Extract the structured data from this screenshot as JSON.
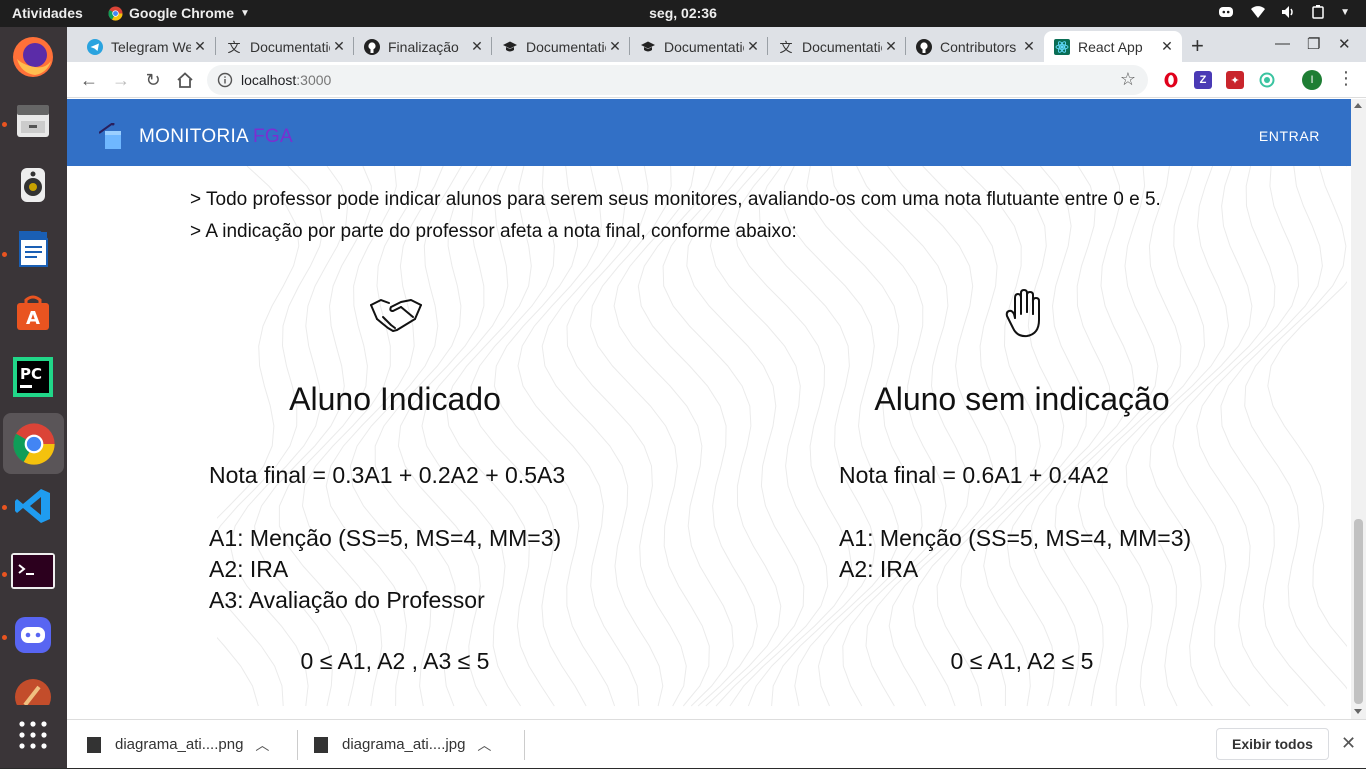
{
  "topbar": {
    "activities": "Atividades",
    "app_name": "Google Chrome",
    "clock": "seg, 02:36"
  },
  "tabs": [
    {
      "title": "Telegram Web",
      "icon": "telegram-icon"
    },
    {
      "title": "Documentation",
      "icon": "translate-icon"
    },
    {
      "title": "Finalização",
      "icon": "github-icon"
    },
    {
      "title": "Documentation",
      "icon": "graduation-cap-icon"
    },
    {
      "title": "Documentation",
      "icon": "graduation-cap-icon"
    },
    {
      "title": "Documentation",
      "icon": "translate-icon"
    },
    {
      "title": "Contributors",
      "icon": "github-icon"
    },
    {
      "title": "React App",
      "icon": "react-icon",
      "active": true
    }
  ],
  "toolbar": {
    "url_host": "localhost",
    "url_port": ":3000",
    "avatar_letter": "I"
  },
  "appbar": {
    "brand": "MONITORIA",
    "brand_accent": "FGA",
    "login": "ENTRAR"
  },
  "content": {
    "rule1": "> Todo professor pode indicar alunos para serem seus monitores, avaliando-os com uma nota flutuante entre 0 e 5.",
    "rule2": "> A indicação por parte do professor afeta a nota final, conforme abaixo:",
    "left": {
      "title": "Aluno Indicado",
      "formula": "Nota final = 0.3A1 + 0.2A2 + 0.5A3",
      "def1": "A1: Menção (SS=5, MS=4, MM=3)",
      "def2": "A2: IRA",
      "def3": "A3: Avaliação do Professor",
      "range": "0 ≤ A1, A2 , A3 ≤ 5"
    },
    "right": {
      "title": "Aluno sem indicação",
      "formula": "Nota final = 0.6A1 + 0.4A2",
      "def1": "A1: Menção (SS=5, MS=4, MM=3)",
      "def2": "A2: IRA",
      "range": "0 ≤ A1, A2 ≤ 5"
    }
  },
  "downloads": {
    "items": [
      {
        "name": "diagrama_ati....png"
      },
      {
        "name": "diagrama_ati....jpg"
      }
    ],
    "show_all": "Exibir todos"
  },
  "colors": {
    "appbar": "#3270c6",
    "brand_accent": "#7b2fd0"
  }
}
